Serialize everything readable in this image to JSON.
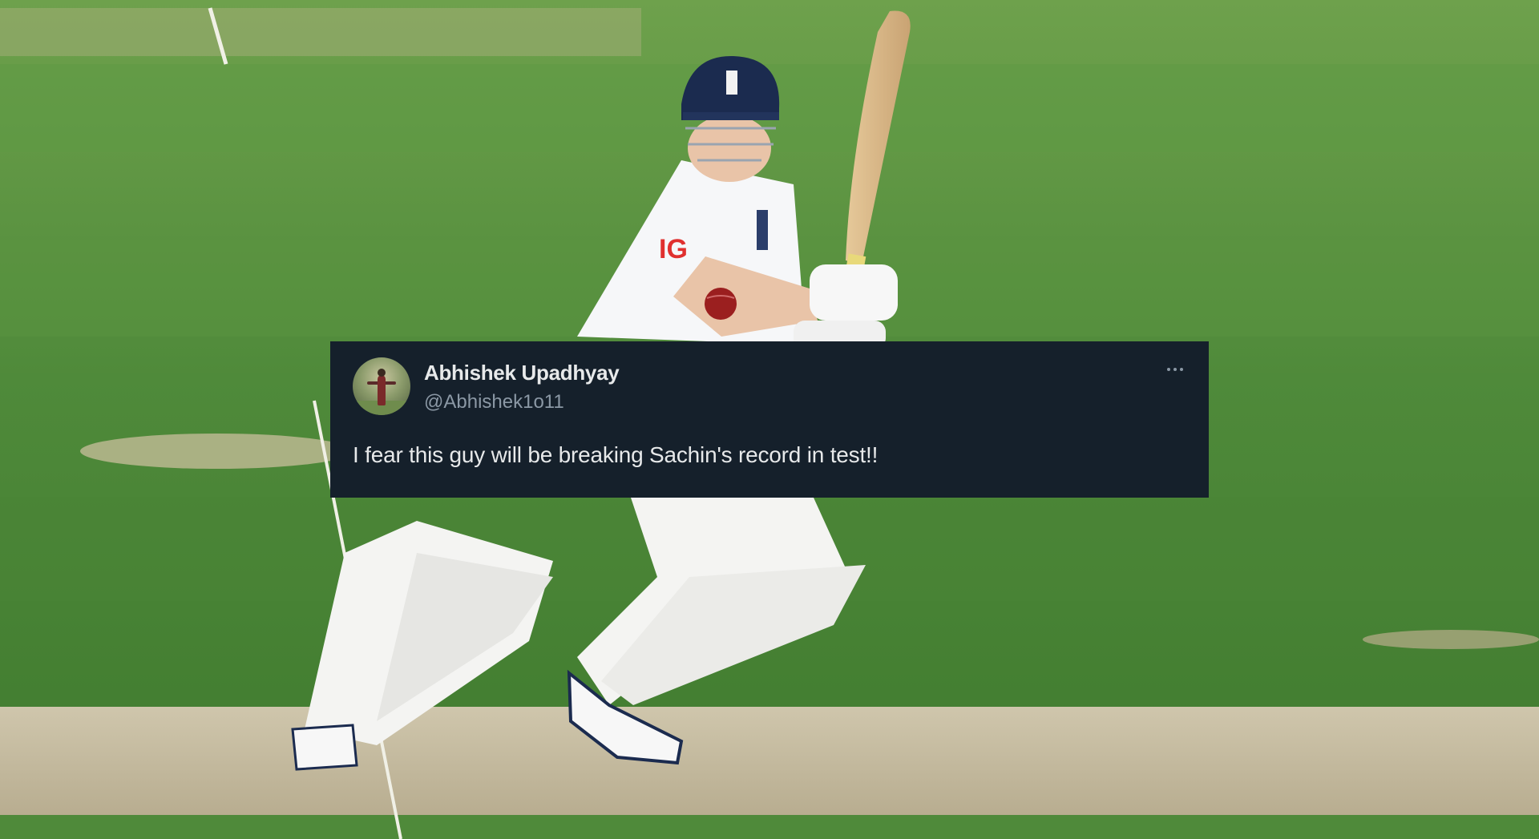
{
  "tweet": {
    "display_name": "Abhishek Upadhyay",
    "handle": "@Abhishek1o11",
    "text": "I fear this guy will be breaking Sachin's record in test!!",
    "more_icon": "more-horizontal-icon"
  },
  "scene": {
    "shirt_sponsor": "IG",
    "colors": {
      "grass": "#4f8a3a",
      "pitch": "#c9bfa3",
      "card_background": "#15202b",
      "helmet": "#1b2b4f",
      "ball": "#9b1f1f"
    }
  }
}
